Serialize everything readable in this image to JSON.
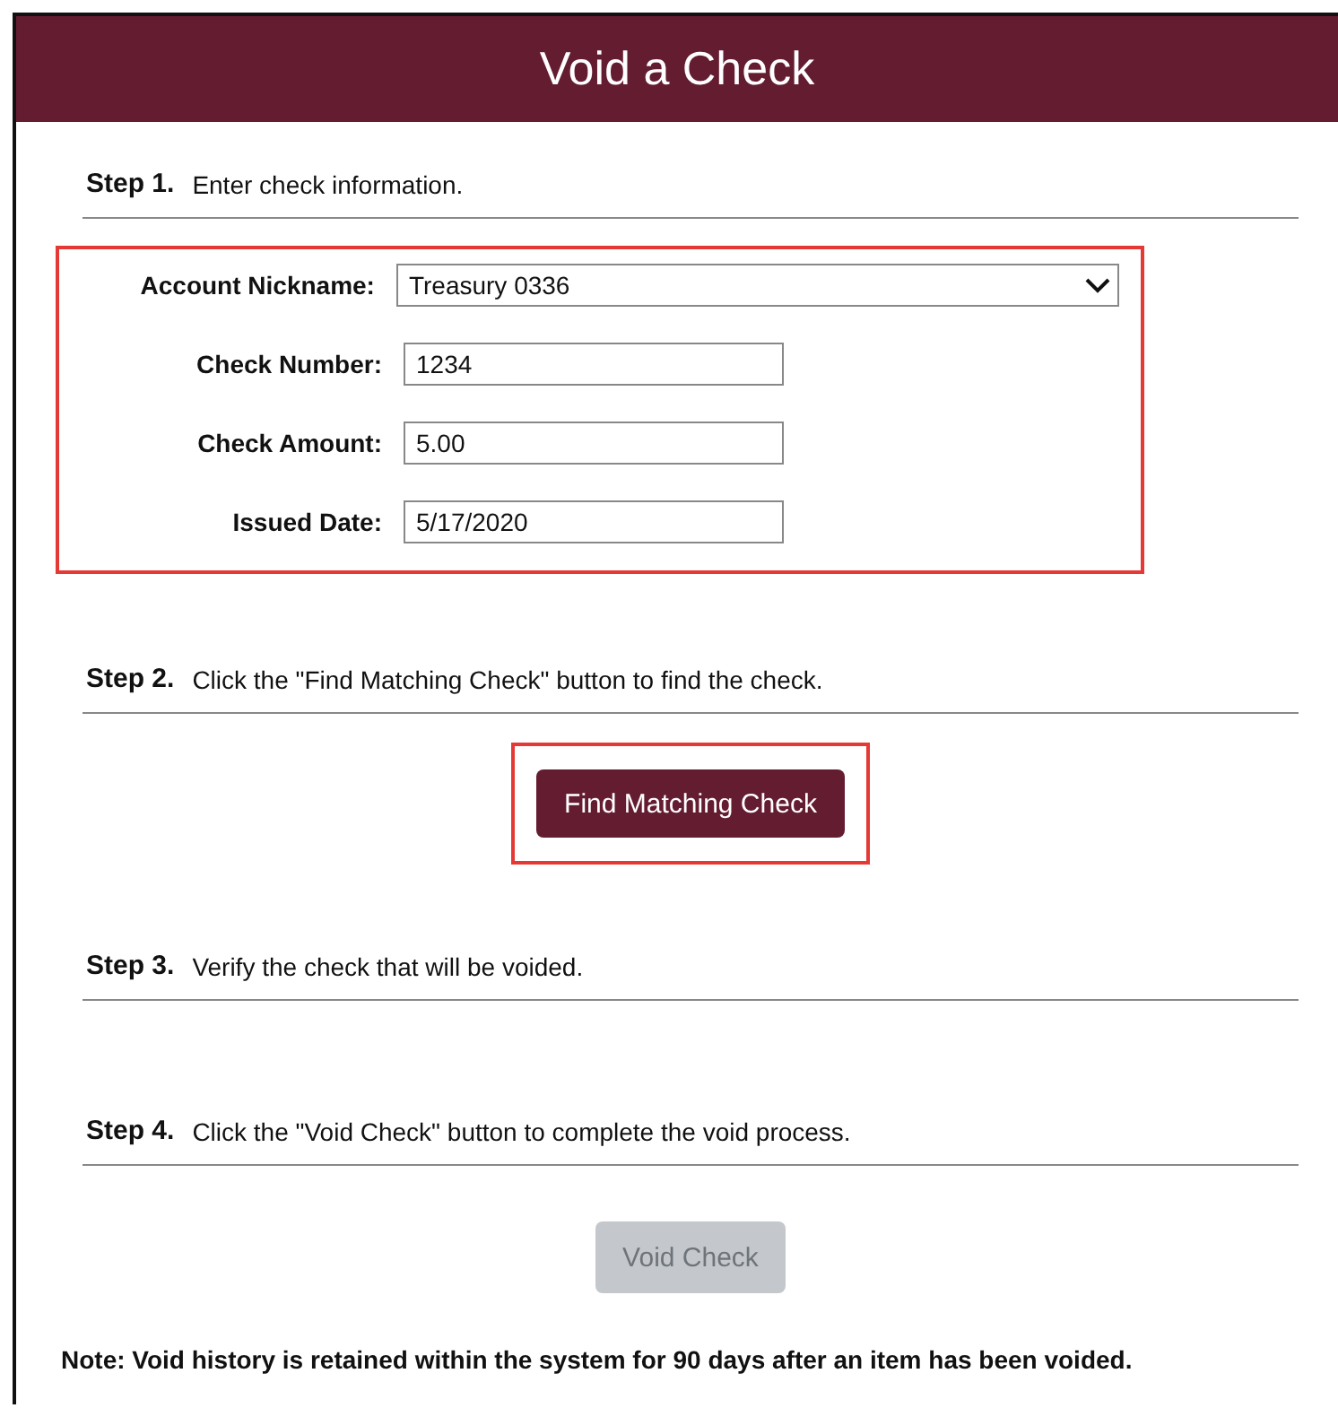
{
  "header": {
    "title": "Void a Check"
  },
  "steps": [
    {
      "label": "Step 1.",
      "text": "Enter check information.",
      "form": {
        "highlighted": true,
        "fields": [
          {
            "label": "Account Nickname:",
            "kind": "select",
            "value": "Treasury 0336"
          },
          {
            "label": "Check Number:",
            "kind": "text",
            "value": "1234"
          },
          {
            "label": "Check Amount:",
            "kind": "text",
            "value": "5.00"
          },
          {
            "label": "Issued Date:",
            "kind": "text",
            "value": "5/17/2020"
          }
        ]
      }
    },
    {
      "label": "Step 2.",
      "text": "Click the \"Find Matching Check\" button to find the check.",
      "button": {
        "label": "Find Matching Check",
        "disabled": false,
        "highlighted": true
      }
    },
    {
      "label": "Step 3.",
      "text": "Verify the check that will be voided."
    },
    {
      "label": "Step 4.",
      "text": "Click the \"Void Check\" button to complete the void process.",
      "button": {
        "label": "Void Check",
        "disabled": true
      }
    }
  ],
  "note": "Note: Void history is retained within the system for 90 days after an item has been voided."
}
